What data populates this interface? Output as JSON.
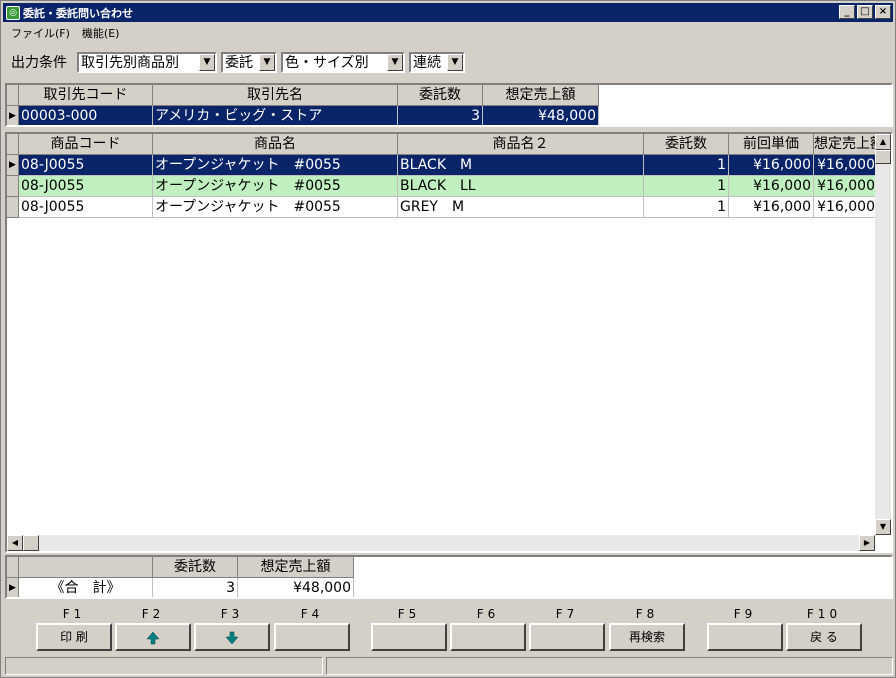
{
  "window": {
    "title": "委託・委託問い合わせ",
    "minimize": "_",
    "maximize": "□",
    "close": "×"
  },
  "menu": [
    {
      "label": "ファイル(F)"
    },
    {
      "label": "機能(E)"
    }
  ],
  "conditions": {
    "label": "出力条件",
    "combos": [
      {
        "value": "取引先別商品別"
      },
      {
        "value": "委託"
      },
      {
        "value": "色・サイズ別"
      },
      {
        "value": "連続"
      }
    ]
  },
  "customer_grid": {
    "headers": [
      "取引先コード",
      "取引先名",
      "委託数",
      "想定売上額"
    ],
    "rows": [
      {
        "code": "00003-000",
        "name": "アメリカ・ビッグ・ストア",
        "qty": "3",
        "amount": "¥48,000"
      }
    ]
  },
  "product_grid": {
    "headers": [
      "商品コード",
      "商品名",
      "商品名２",
      "委託数",
      "前回単価",
      "想定売上額"
    ],
    "rows": [
      {
        "code": "08-J0055",
        "name": "オープンジャケット　#0055",
        "name2": "BLACK　M",
        "qty": "1",
        "price": "¥16,000",
        "amount": "¥16,000"
      },
      {
        "code": "08-J0055",
        "name": "オープンジャケット　#0055",
        "name2": "BLACK　LL",
        "qty": "1",
        "price": "¥16,000",
        "amount": "¥16,000"
      },
      {
        "code": "08-J0055",
        "name": "オープンジャケット　#0055",
        "name2": "GREY　M",
        "qty": "1",
        "price": "¥16,000",
        "amount": "¥16,000"
      }
    ]
  },
  "total_grid": {
    "headers": [
      "",
      "委託数",
      "想定売上額"
    ],
    "row": {
      "label": "《合　計》",
      "qty": "3",
      "amount": "¥48,000"
    }
  },
  "fkeys": [
    {
      "key": "F1",
      "label": "印 刷"
    },
    {
      "key": "F2",
      "label": "",
      "icon": "up-arrow-icon"
    },
    {
      "key": "F3",
      "label": "",
      "icon": "down-arrow-icon"
    },
    {
      "key": "F4",
      "label": ""
    },
    {
      "key": "F5",
      "label": ""
    },
    {
      "key": "F6",
      "label": ""
    },
    {
      "key": "F7",
      "label": ""
    },
    {
      "key": "F8",
      "label": "再検索"
    },
    {
      "key": "F9",
      "label": ""
    },
    {
      "key": "F10",
      "label": "戻 る"
    }
  ],
  "colors": {
    "title_bar": "#0a246a",
    "selected_row": "#0a246a",
    "alt_row": "#c0f0c0",
    "arrow_icon": "#008080"
  }
}
